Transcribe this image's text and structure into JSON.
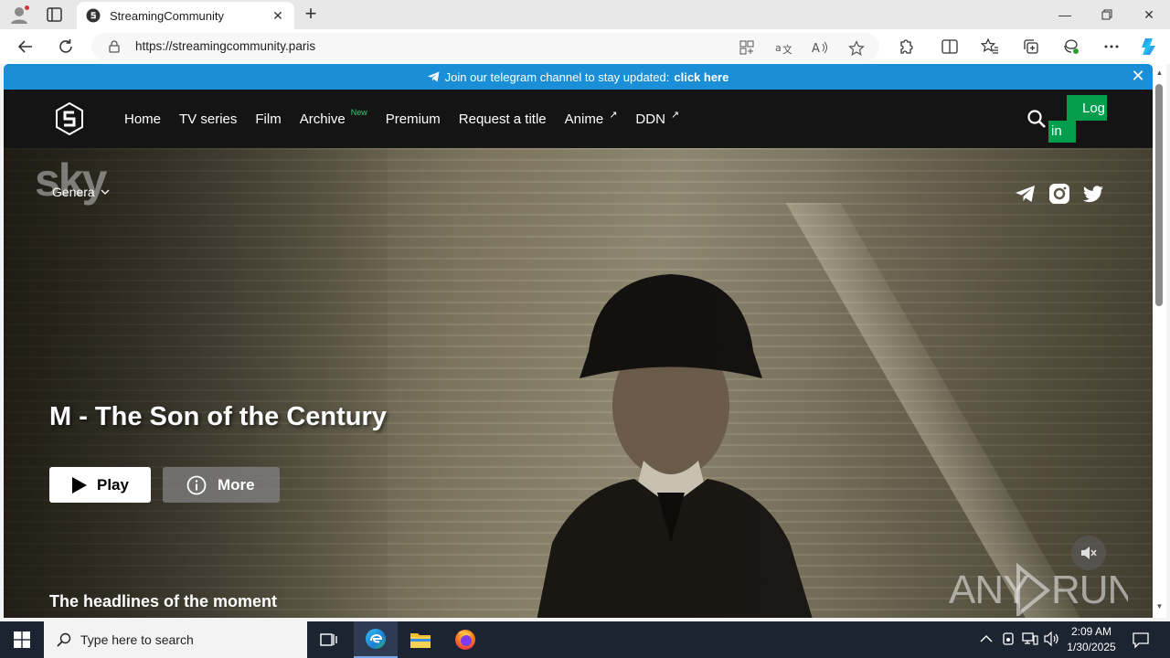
{
  "browser": {
    "tab_title": "StreamingCommunity",
    "url": "https://streamingcommunity.paris"
  },
  "site": {
    "banner": {
      "text": "Join our telegram channel to stay updated:",
      "cta": "click here"
    },
    "nav": {
      "items": [
        {
          "label": "Home"
        },
        {
          "label": "TV series"
        },
        {
          "label": "Film"
        },
        {
          "label": "Archive",
          "badge": "New"
        },
        {
          "label": "Premium"
        },
        {
          "label": "Request a title"
        },
        {
          "label": "Anime",
          "external": "↗"
        },
        {
          "label": "DDN",
          "external": "↗"
        }
      ],
      "login_line1": "Log",
      "login_line2": "in"
    },
    "hero": {
      "channel_logo": "sky",
      "genre_dropdown": "Genera",
      "title": "M - The Son of the Century",
      "play_label": "Play",
      "more_label": "More",
      "section_heading": "The headlines of the moment",
      "watermark": "ANY RUN"
    }
  },
  "taskbar": {
    "search_placeholder": "Type here to search",
    "time": "2:09 AM",
    "date": "1/30/2025"
  },
  "colors": {
    "banner_bg": "#1a8fd8",
    "login_bg": "#049d4e",
    "new_badge": "#2ecc71",
    "nav_bg": "#141414"
  }
}
